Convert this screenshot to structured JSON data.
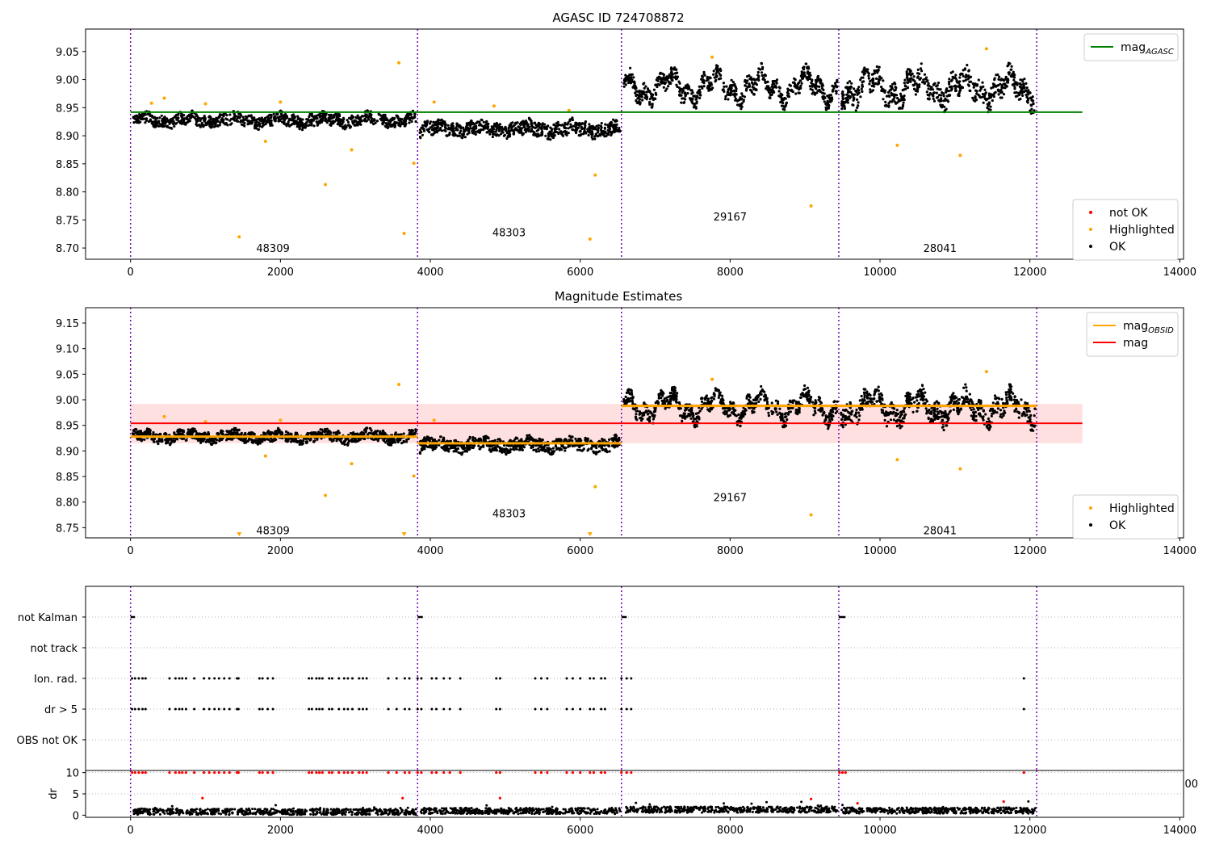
{
  "chart_data": [
    {
      "id": "panel-top",
      "type": "scatter",
      "title": "AGASC ID 724708872",
      "xlim": [
        -600,
        14050
      ],
      "ylim": [
        8.68,
        9.09
      ],
      "x_ticks": [
        0,
        2000,
        4000,
        6000,
        8000,
        10000,
        12000,
        14000
      ],
      "y_ticks": [
        8.7,
        8.75,
        8.8,
        8.85,
        8.9,
        8.95,
        9.0,
        9.05
      ],
      "obsid_boundaries": [
        0,
        3830,
        6550,
        9450,
        12090
      ],
      "obsid_labels": [
        {
          "text": "48309",
          "x": 1900,
          "y": 8.7
        },
        {
          "text": "48303",
          "x": 5050,
          "y": 8.728
        },
        {
          "text": "29167",
          "x": 8000,
          "y": 8.756
        },
        {
          "text": "28041",
          "x": 10800,
          "y": 8.7
        }
      ],
      "segments": [
        {
          "x0": 0,
          "x1": 3830,
          "base": 8.928,
          "spread": 0.01
        },
        {
          "x0": 3830,
          "x1": 6550,
          "base": 8.912,
          "spread": 0.012
        },
        {
          "x0": 6550,
          "x1": 9450,
          "base": 8.987,
          "spread": 0.014
        },
        {
          "x0": 9450,
          "x1": 12090,
          "base": 8.985,
          "spread": 0.018
        }
      ],
      "mag_agasc": {
        "value": 8.942,
        "x_range": [
          0,
          12700
        ],
        "color": "#008000"
      },
      "highlighted_points": [
        {
          "x": 1450,
          "y": 8.72
        },
        {
          "x": 2600,
          "y": 8.813
        },
        {
          "x": 2950,
          "y": 8.875
        },
        {
          "x": 3580,
          "y": 9.03
        },
        {
          "x": 3650,
          "y": 8.726
        },
        {
          "x": 3780,
          "y": 8.851
        },
        {
          "x": 5850,
          "y": 8.945
        },
        {
          "x": 6130,
          "y": 8.716
        },
        {
          "x": 6200,
          "y": 8.83
        },
        {
          "x": 7760,
          "y": 9.04
        },
        {
          "x": 9080,
          "y": 8.775
        },
        {
          "x": 10230,
          "y": 8.883
        },
        {
          "x": 11070,
          "y": 8.865
        },
        {
          "x": 11420,
          "y": 9.055
        },
        {
          "x": 450,
          "y": 8.967
        },
        {
          "x": 1000,
          "y": 8.957
        },
        {
          "x": 2000,
          "y": 8.96
        },
        {
          "x": 4050,
          "y": 8.96
        },
        {
          "x": 4850,
          "y": 8.953
        },
        {
          "x": 280,
          "y": 8.958
        },
        {
          "x": 1800,
          "y": 8.89
        }
      ],
      "legend_upper": [
        {
          "label": "mag",
          "subscript": "AGASC",
          "color": "#008000",
          "kind": "line"
        }
      ],
      "legend_lower": [
        {
          "label": "not OK",
          "color": "#ff0000",
          "kind": "dot"
        },
        {
          "label": "Highlighted",
          "color": "#ffa500",
          "kind": "dot"
        },
        {
          "label": "OK",
          "color": "#000000",
          "kind": "dot"
        }
      ]
    },
    {
      "id": "panel-middle",
      "type": "scatter",
      "title": "Magnitude Estimates",
      "xlim": [
        -600,
        14050
      ],
      "ylim": [
        8.73,
        9.18
      ],
      "x_ticks": [
        0,
        2000,
        4000,
        6000,
        8000,
        10000,
        12000,
        14000
      ],
      "y_ticks": [
        8.75,
        8.8,
        8.85,
        8.9,
        8.95,
        9.0,
        9.05,
        9.1,
        9.15
      ],
      "obsid_boundaries": [
        0,
        3830,
        6550,
        9450,
        12090
      ],
      "obsid_labels": [
        {
          "text": "48309",
          "x": 1900,
          "y": 8.745
        },
        {
          "text": "48303",
          "x": 5050,
          "y": 8.778
        },
        {
          "text": "29167",
          "x": 8000,
          "y": 8.81
        },
        {
          "text": "28041",
          "x": 10800,
          "y": 8.745
        }
      ],
      "segments": [
        {
          "x0": 0,
          "x1": 3830,
          "base": 8.928,
          "spread": 0.01
        },
        {
          "x0": 3830,
          "x1": 6550,
          "base": 8.912,
          "spread": 0.012
        },
        {
          "x0": 6550,
          "x1": 9450,
          "base": 8.987,
          "spread": 0.014
        },
        {
          "x0": 9450,
          "x1": 12090,
          "base": 8.985,
          "spread": 0.018
        }
      ],
      "mag": {
        "value": 8.954,
        "band": [
          8.915,
          8.992
        ],
        "x_range": [
          0,
          12700
        ],
        "color": "#ff0000"
      },
      "mag_obsid": [
        {
          "x0": 0,
          "x1": 3830,
          "value": 8.928
        },
        {
          "x0": 3830,
          "x1": 6550,
          "value": 8.915
        },
        {
          "x0": 6550,
          "x1": 9450,
          "value": 8.988
        },
        {
          "x0": 9450,
          "x1": 12090,
          "value": 8.988
        }
      ],
      "highlighted_points": [
        {
          "x": 2600,
          "y": 8.813
        },
        {
          "x": 2950,
          "y": 8.875
        },
        {
          "x": 3580,
          "y": 9.03
        },
        {
          "x": 3780,
          "y": 8.851
        },
        {
          "x": 6200,
          "y": 8.83
        },
        {
          "x": 7760,
          "y": 9.04
        },
        {
          "x": 9080,
          "y": 8.775
        },
        {
          "x": 10230,
          "y": 8.883
        },
        {
          "x": 11070,
          "y": 8.865
        },
        {
          "x": 11420,
          "y": 9.055
        },
        {
          "x": 450,
          "y": 8.967
        },
        {
          "x": 1000,
          "y": 8.957
        },
        {
          "x": 2000,
          "y": 8.96
        },
        {
          "x": 4050,
          "y": 8.96
        },
        {
          "x": 1800,
          "y": 8.89
        }
      ],
      "clipped_markers": [
        {
          "x": 1450
        },
        {
          "x": 3650
        },
        {
          "x": 6130
        }
      ],
      "legend_upper": [
        {
          "label": "mag",
          "subscript": "OBSID",
          "color": "#ffa500",
          "kind": "line"
        },
        {
          "label": "mag",
          "subscript": "",
          "color": "#ff0000",
          "kind": "line"
        }
      ],
      "legend_lower": [
        {
          "label": "Highlighted",
          "color": "#ffa500",
          "kind": "dot"
        },
        {
          "label": "OK",
          "color": "#000000",
          "kind": "dot"
        }
      ]
    },
    {
      "id": "panel-flags",
      "type": "scatter",
      "xlim": [
        -600,
        14050
      ],
      "x_ticks": [
        0,
        2000,
        4000,
        6000,
        8000,
        10000,
        12000,
        14000
      ],
      "categories": [
        "not Kalman",
        "not track",
        "Ion. rad.",
        "dr > 5",
        "OBS not OK"
      ],
      "obsid_boundaries": [
        0,
        3830,
        6550,
        9450,
        12090
      ],
      "not_kalman_ranges": [
        [
          0,
          60
        ],
        [
          3830,
          3900
        ],
        [
          6550,
          6620
        ],
        [
          9450,
          9540
        ]
      ],
      "flag_x": [
        20,
        60,
        110,
        160,
        200,
        520,
        600,
        650,
        690,
        740,
        850,
        980,
        1050,
        1120,
        1180,
        1250,
        1320,
        1420,
        1440,
        1720,
        1760,
        1830,
        1900,
        2380,
        2420,
        2480,
        2520,
        2560,
        2650,
        2690,
        2780,
        2850,
        2900,
        2960,
        3050,
        3100,
        3150,
        3440,
        3550,
        3660,
        3720,
        3830,
        3880,
        4020,
        4080,
        4180,
        4260,
        4400,
        4880,
        4930,
        5400,
        5480,
        5560,
        5820,
        5900,
        6000,
        6130,
        6180,
        6280,
        6330,
        6550,
        6620,
        6680,
        11920
      ]
    },
    {
      "id": "panel-dr",
      "type": "scatter",
      "ylabel": "dr",
      "xlim": [
        -600,
        14050
      ],
      "ylim": [
        -0.5,
        10.5
      ],
      "x_ticks": [
        0,
        2000,
        4000,
        6000,
        8000,
        10000,
        12000,
        14000
      ],
      "y_ticks": [
        0,
        5,
        10
      ],
      "extra_tick_label": "00",
      "obsid_boundaries": [
        0,
        3830,
        6550,
        9450,
        12090
      ],
      "segments": [
        {
          "x0": 0,
          "x1": 3830,
          "base": 0.8
        },
        {
          "x0": 3830,
          "x1": 6550,
          "base": 1.0
        },
        {
          "x0": 6550,
          "x1": 9450,
          "base": 1.3
        },
        {
          "x0": 9450,
          "x1": 12090,
          "base": 1.1
        }
      ],
      "red_points": [
        {
          "x": 960,
          "y": 4.0
        },
        {
          "x": 3630,
          "y": 4.0
        },
        {
          "x": 4930,
          "y": 4.0
        },
        {
          "x": 9080,
          "y": 3.8
        },
        {
          "x": 9700,
          "y": 2.8
        },
        {
          "x": 11650,
          "y": 3.2
        }
      ]
    }
  ]
}
